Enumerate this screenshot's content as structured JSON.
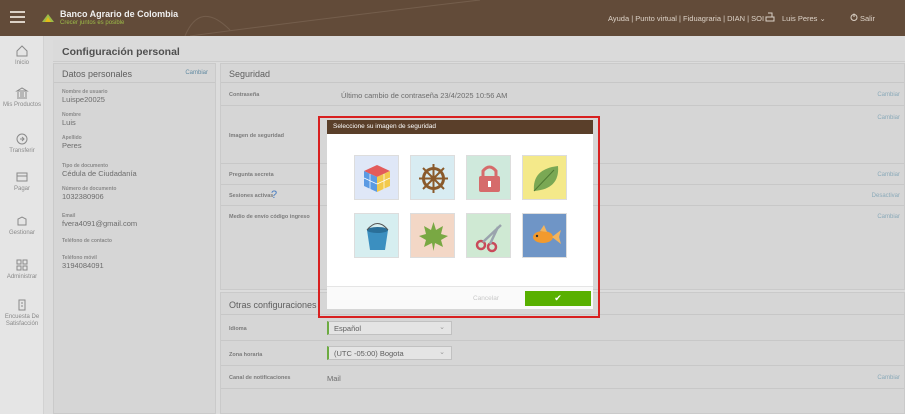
{
  "topbar": {
    "bank_name": "Banco Agrario de Colombia",
    "slogan": "Crecer juntos es posible",
    "links": "Ayuda | Punto virtual | Fiduagraria | DIAN | SOI",
    "user": "Luis Peres ⌄",
    "exit": "Salir"
  },
  "sidebar": {
    "items": [
      {
        "label": "Inicio",
        "icon": "home-icon"
      },
      {
        "label": "Mis Productos",
        "icon": "bank-icon"
      },
      {
        "label": "Transferir",
        "icon": "transfer-icon"
      },
      {
        "label": "Pagar",
        "icon": "pay-icon"
      },
      {
        "label": "Gestionar",
        "icon": "manage-icon"
      },
      {
        "label": "Administrar",
        "icon": "admin-icon"
      },
      {
        "label": "Encuesta De Satisfacción",
        "icon": "survey-icon"
      }
    ]
  },
  "header": {
    "title": "Configuración personal"
  },
  "personal": {
    "title": "Datos personales",
    "change": "Cambiar",
    "fields": [
      {
        "label": "Nombre de usuario",
        "value": "Luispe20025"
      },
      {
        "label": "Nombre",
        "value": "Luis"
      },
      {
        "label": "Apellido",
        "value": "Peres"
      },
      {
        "label": "Tipo de documento",
        "value": "Cédula de Ciudadanía"
      },
      {
        "label": "Número de documento",
        "value": "1032380906"
      },
      {
        "label": "Email",
        "value": "fvera4091@gmail.com"
      },
      {
        "label": "Teléfono de contacto",
        "value": ""
      },
      {
        "label": "Teléfono móvil",
        "value": "3194084091"
      }
    ]
  },
  "security": {
    "title": "Seguridad",
    "rows": [
      {
        "label": "Contraseña",
        "value": "Último cambio de contraseña 23/4/2025 10:56 AM",
        "action": "Cambiar"
      },
      {
        "label": "Imagen de seguridad",
        "value": "",
        "action": "Cambiar"
      },
      {
        "label": "Pregunta secreta",
        "value": "",
        "action": "Cambiar"
      },
      {
        "label": "Sesiones activas",
        "value": "",
        "action": "Desactivar",
        "help": "?"
      },
      {
        "label": "Medio de envío código ingreso",
        "value": "",
        "action": "Cambiar"
      }
    ]
  },
  "other": {
    "title": "Otras configuraciones",
    "language_label": "Idioma",
    "language_value": "Español",
    "timezone_label": "Zona horaria",
    "timezone_value": "(UTC -05:00) Bogota",
    "notify_label": "Canal de notificaciones",
    "notify_value": "Mail",
    "notify_action": "Cambiar"
  },
  "modal": {
    "title": "Seleccione su imagen de seguridad",
    "images": [
      "rubik-cube-icon",
      "ship-wheel-icon",
      "padlock-icon",
      "leaf-icon",
      "bucket-icon",
      "maple-leaf-icon",
      "scissors-icon",
      "goldfish-icon"
    ],
    "cancel_label": "Cancelar",
    "ok_label": "✔"
  },
  "colors": {
    "brand_brown": "#5a3f2a",
    "accent_green": "#58b000",
    "highlight_red": "#d82020"
  }
}
